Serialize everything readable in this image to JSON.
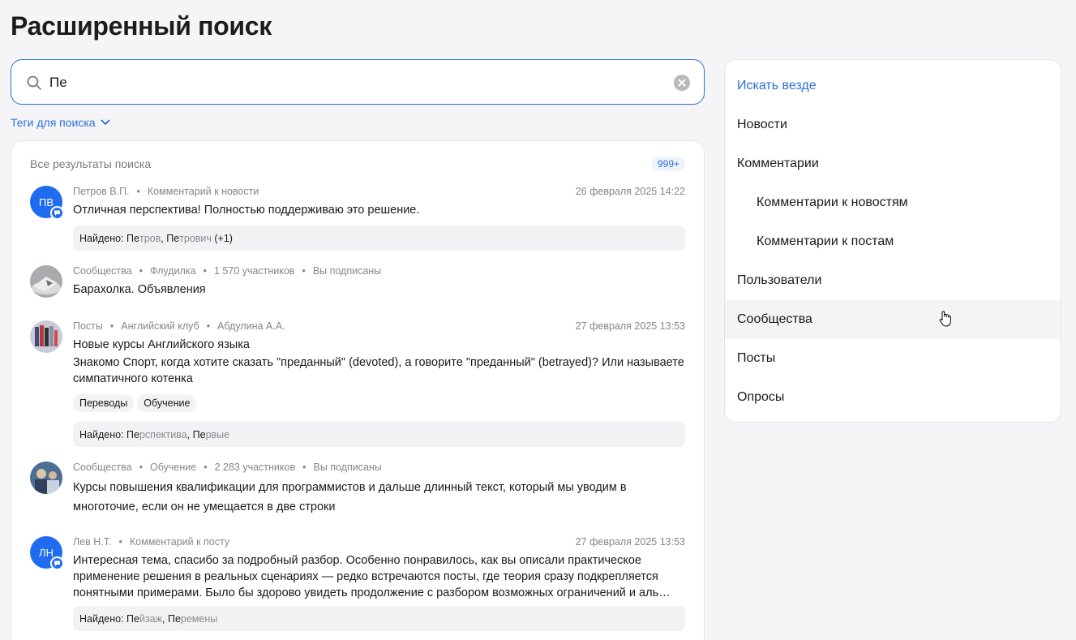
{
  "page": {
    "title": "Расширенный поиск"
  },
  "search": {
    "value": "Пе",
    "placeholder": ""
  },
  "tags_toggle": {
    "label": "Теги для поиска"
  },
  "results": {
    "title": "Все результаты поиска",
    "count": "999+",
    "items": [
      {
        "avatar_initials": "ПВ",
        "meta": [
          "Петров В.П.",
          "Комментарий к новости"
        ],
        "date": "26 февраля 2025 14:22",
        "text": "Отличная перспектива! Полностью поддерживаю это решение.",
        "found_label": "Найдено:",
        "found": [
          {
            "hit": "Пе",
            "rest": "тров"
          },
          {
            "hit": "Пе",
            "rest": "трович"
          }
        ],
        "found_more": "(+1)"
      },
      {
        "meta": [
          "Сообщества",
          "Флудилка",
          "1 570 участников",
          "Вы подписаны"
        ],
        "title": "Барахолка. Объявления"
      },
      {
        "meta": [
          "Посты",
          "Английский клуб",
          "Абдулина А.А."
        ],
        "date": "27 февраля 2025 13:53",
        "title": "Новые курсы Английского языка",
        "text": "Знакомо Спорт, когда хотите сказать \"преданный\" (devoted), а говорите \"преданный\" (betrayed)? Или называете симпатичного котенка",
        "tags": [
          "Переводы",
          "Обучение"
        ],
        "found_label": "Найдено:",
        "found": [
          {
            "hit": "Пе",
            "rest": "рспектива"
          },
          {
            "hit": "Пе",
            "rest": "рвые"
          }
        ]
      },
      {
        "meta": [
          "Сообщества",
          "Обучение",
          "2 283 участников",
          "Вы подписаны"
        ],
        "title": "Курсы повышения квалификации для программистов и дальше длинный текст, который мы уводим в многоточие, если он не умещается в две строки"
      },
      {
        "avatar_initials": "ЛН",
        "meta": [
          "Лев Н.Т.",
          "Комментарий к посту"
        ],
        "date": "27 февраля 2025 13:53",
        "text": "Интересная тема, спасибо за подробный разбор. Особенно понравилось, как вы описали практическое применение решения в реальных сценариях — редко встречаются посты, где теория сразу подкрепляется понятными примерами. Было бы здорово увидеть продолжение с разбором возможных ограничений и аль…",
        "found_label": "Найдено:",
        "found": [
          {
            "hit": "Пе",
            "rest": "йзаж"
          },
          {
            "hit": "Пе",
            "rest": "ремены"
          }
        ]
      }
    ]
  },
  "sidebar": {
    "items": [
      {
        "label": "Искать везде"
      },
      {
        "label": "Новости"
      },
      {
        "label": "Комментарии"
      },
      {
        "label": "Комментарии к новостям"
      },
      {
        "label": "Комментарии к постам"
      },
      {
        "label": "Пользователи"
      },
      {
        "label": "Сообщества"
      },
      {
        "label": "Посты"
      },
      {
        "label": "Опросы"
      }
    ]
  },
  "colors": {
    "accent": "#2d6fd6",
    "avatar": "#1f6cf0"
  }
}
